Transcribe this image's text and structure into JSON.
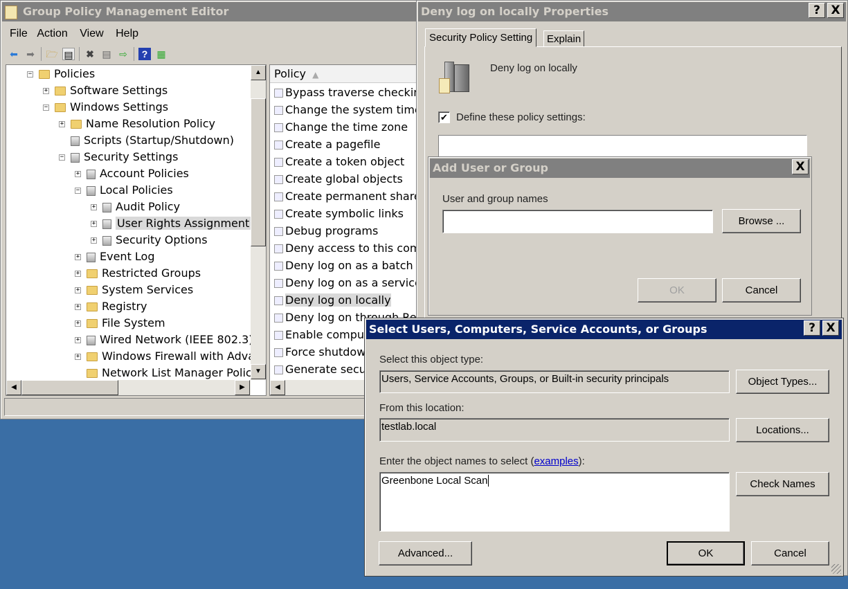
{
  "gpme": {
    "title": "Group Policy Management Editor",
    "menu": [
      "File",
      "Action",
      "View",
      "Help"
    ],
    "toolbar": [
      "back-icon",
      "forward-icon",
      "up-folder-icon",
      "show-hide-tree-icon",
      "delete-icon",
      "properties-icon",
      "export-icon",
      "help-icon",
      "show-action-pane-icon"
    ],
    "tree": [
      {
        "label": "Policies",
        "level": 0,
        "exp": "-",
        "icon": "folder"
      },
      {
        "label": "Software Settings",
        "level": 1,
        "exp": "+",
        "icon": "folder"
      },
      {
        "label": "Windows Settings",
        "level": 1,
        "exp": "-",
        "icon": "folder"
      },
      {
        "label": "Name Resolution Policy",
        "level": 2,
        "exp": "+",
        "icon": "folder"
      },
      {
        "label": "Scripts (Startup/Shutdown)",
        "level": 2,
        "exp": "",
        "icon": "script"
      },
      {
        "label": "Security Settings",
        "level": 2,
        "exp": "-",
        "icon": "security"
      },
      {
        "label": "Account Policies",
        "level": 3,
        "exp": "+",
        "icon": "policy"
      },
      {
        "label": "Local Policies",
        "level": 3,
        "exp": "-",
        "icon": "policy"
      },
      {
        "label": "Audit Policy",
        "level": 4,
        "exp": "+",
        "icon": "policy"
      },
      {
        "label": "User Rights Assignment",
        "level": 4,
        "exp": "+",
        "icon": "policy",
        "selected": true
      },
      {
        "label": "Security Options",
        "level": 4,
        "exp": "+",
        "icon": "policy"
      },
      {
        "label": "Event Log",
        "level": 3,
        "exp": "+",
        "icon": "policy"
      },
      {
        "label": "Restricted Groups",
        "level": 3,
        "exp": "+",
        "icon": "lockfolder"
      },
      {
        "label": "System Services",
        "level": 3,
        "exp": "+",
        "icon": "lockfolder"
      },
      {
        "label": "Registry",
        "level": 3,
        "exp": "+",
        "icon": "lockfolder"
      },
      {
        "label": "File System",
        "level": 3,
        "exp": "+",
        "icon": "lockfolder"
      },
      {
        "label": "Wired Network (IEEE 802.3)",
        "level": 3,
        "exp": "+",
        "icon": "network"
      },
      {
        "label": "Windows Firewall with Advan",
        "level": 3,
        "exp": "+",
        "icon": "folder"
      },
      {
        "label": "Network List Manager Policie",
        "level": 3,
        "exp": "",
        "icon": "folder"
      }
    ],
    "list_header": "Policy",
    "policies": [
      "Bypass traverse checking",
      "Change the system time",
      "Change the time zone",
      "Create a pagefile",
      "Create a token object",
      "Create global objects",
      "Create permanent shared",
      "Create symbolic links",
      "Debug programs",
      "Deny access to this comp",
      "Deny log on as a batch jo",
      "Deny log on as a service",
      "Deny log on locally",
      "Deny log on through Rem",
      "Enable compute",
      "Force shutdown",
      "Generate secur"
    ],
    "selected_policy": "Deny log on locally"
  },
  "props": {
    "title": "Deny log on locally Properties",
    "help": "?",
    "close": "X",
    "tabs": [
      "Security Policy Setting",
      "Explain"
    ],
    "policy_name": "Deny log on locally",
    "define_label": "Define these policy settings:",
    "define_checked": true
  },
  "add": {
    "title": "Add User or Group",
    "close": "X",
    "names_label": "User and group names",
    "names_value": "",
    "browse": "Browse ...",
    "ok": "OK",
    "cancel": "Cancel"
  },
  "select": {
    "title": "Select Users, Computers, Service Accounts, or Groups",
    "help": "?",
    "close": "X",
    "type_label": "Select this object type:",
    "type_value": "Users, Service Accounts, Groups, or Built-in security principals",
    "object_types": "Object Types...",
    "loc_label": "From this location:",
    "loc_value": "testlab.local",
    "locations": "Locations...",
    "enter_label_pre": "Enter the object names to select (",
    "enter_link": "examples",
    "enter_label_post": "):",
    "names_value": "Greenbone Local Scan",
    "check_names": "Check Names",
    "advanced": "Advanced...",
    "ok": "OK",
    "cancel": "Cancel"
  },
  "colors": {
    "desktop": "#3a6ea5",
    "active_title": "#0a246a",
    "inactive_title": "#808080",
    "link": "#0000cc"
  }
}
